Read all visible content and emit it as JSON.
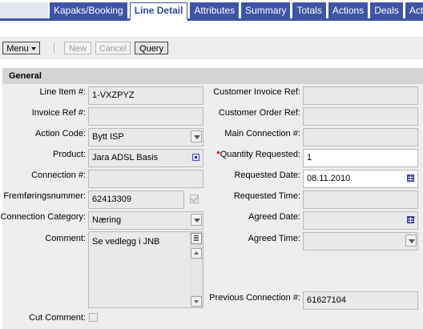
{
  "tabs": [
    "Kapaks/Booking",
    "Line Detail",
    "Attributes",
    "Summary",
    "Totals",
    "Actions",
    "Deals",
    "Activit"
  ],
  "active_tab": "Line Detail",
  "toolbar": {
    "menu_label": "Menu",
    "new_label": "New",
    "cancel_label": "Cancel",
    "query_label": "Query"
  },
  "section": {
    "title": "General"
  },
  "left": {
    "line_item_label": "Line Item #:",
    "line_item_value": "1-VXZPYZ",
    "invoice_ref_label": "Invoice Ref #:",
    "invoice_ref_value": "",
    "action_code_label": "Action Code:",
    "action_code_value": "Bytt ISP",
    "product_label": "Product:",
    "product_value": "Jara ADSL Basis",
    "connection_label": "Connection #:",
    "connection_value": "",
    "fremforing_label": "Fremføringsnummer:",
    "fremforing_value": "62413309",
    "conn_category_label": "Connection Category:",
    "conn_category_value": "Næring",
    "comment_label": "Comment:",
    "comment_value": "Se vedlegg i JNB",
    "cut_comment_label": "Cut Comment:"
  },
  "right": {
    "cust_invoice_ref_label": "Customer Invoice Ref:",
    "cust_invoice_ref_value": "",
    "cust_order_ref_label": "Customer Order Ref:",
    "cust_order_ref_value": "",
    "main_connection_label": "Main Connection #:",
    "main_connection_value": "",
    "qty_required_mark": "*",
    "qty_label": "Quantity Requested:",
    "qty_value": "1",
    "req_date_label": "Requested Date:",
    "req_date_value": "08.11.2010",
    "req_time_label": "Requested Time:",
    "req_time_value": "",
    "agreed_date_label": "Agreed Date:",
    "agreed_date_value": "",
    "agreed_time_label": "Agreed Time:",
    "agreed_time_value": "",
    "prev_connection_label": "Previous Connection #:",
    "prev_connection_value": "61627104"
  },
  "icons": {
    "dropdown": "chevron-down-icon",
    "calendar": "calendar-icon",
    "pick": "pick-applet-icon",
    "check": "checkmark-icon",
    "notes": "notes-icon"
  }
}
